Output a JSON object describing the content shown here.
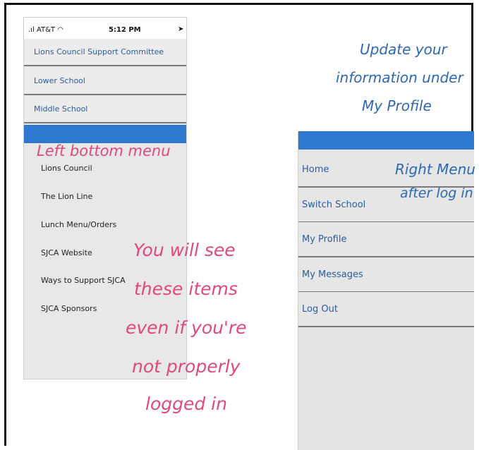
{
  "status_bar": {
    "carrier": "AT&T",
    "time": "5:12 PM",
    "location_glyph": "➤"
  },
  "left_menu": {
    "top_items": [
      {
        "label": "Lions Council Support Committee"
      },
      {
        "label": "Lower School"
      },
      {
        "label": "Middle School"
      }
    ],
    "bar_color": "#2e79cf",
    "bottom_items": [
      {
        "label": "Lions Council"
      },
      {
        "label": "The Lion Line"
      },
      {
        "label": "Lunch Menu/Orders"
      },
      {
        "label": "SJCA Website"
      },
      {
        "label": "Ways to Support SJCA"
      },
      {
        "label": "SJCA Sponsors"
      }
    ]
  },
  "right_menu": {
    "bar_color": "#2e79cf",
    "items": [
      {
        "label": "Home"
      },
      {
        "label": "Switch School"
      },
      {
        "label": "My Profile"
      },
      {
        "label": "My Messages"
      },
      {
        "label": "Log Out"
      }
    ]
  },
  "annotations": {
    "left_bottom_menu": "Left bottom menu",
    "update_line1": "Update your",
    "update_line2": "information under",
    "update_line3": "My Profile",
    "right_menu_line1": "Right Menu",
    "right_menu_line2": "after log in",
    "note_line1": "You will see",
    "note_line2": "these items",
    "note_line3": "even if you're",
    "note_line4": "not properly",
    "note_line5": "logged in"
  },
  "colors": {
    "annotation_pink": "#e0497a",
    "annotation_blue": "#2c68b5",
    "link_blue": "#2b5c9c"
  }
}
